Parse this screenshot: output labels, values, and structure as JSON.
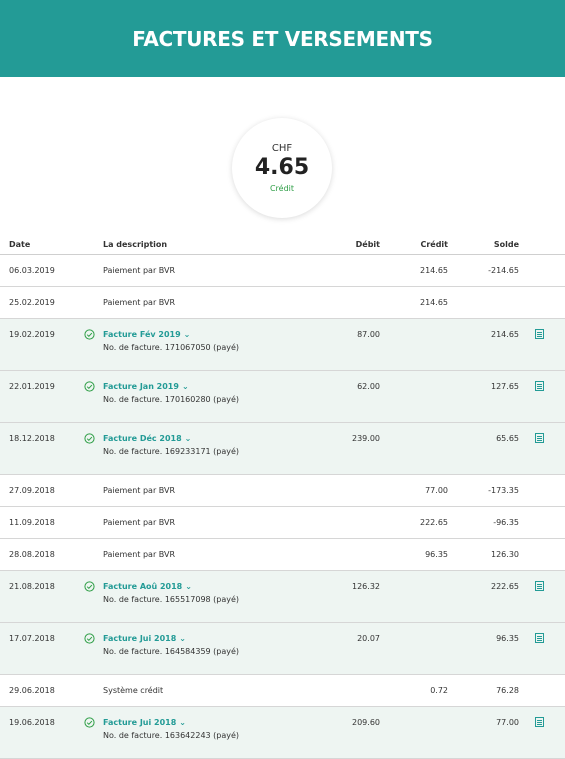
{
  "header": {
    "title": "FACTURES ET VERSEMENTS"
  },
  "balance": {
    "currency": "CHF",
    "amount": "4.65",
    "label": "Crédit"
  },
  "table": {
    "columns": {
      "date": "Date",
      "description": "La description",
      "debit": "Débit",
      "credit": "Crédit",
      "solde": "Solde"
    },
    "rows": [
      {
        "type": "simple",
        "date": "06.03.2019",
        "description": "Paiement par BVR",
        "debit": "",
        "credit": "214.65",
        "solde": "-214.65"
      },
      {
        "type": "simple",
        "date": "25.02.2019",
        "description": "Paiement par BVR",
        "debit": "",
        "credit": "214.65",
        "solde": ""
      },
      {
        "type": "invoice",
        "date": "19.02.2019",
        "title": "Facture Fév 2019",
        "number": "No. de facture. 171067050 (payé)",
        "debit": "87.00",
        "credit": "",
        "solde": "214.65"
      },
      {
        "type": "invoice",
        "date": "22.01.2019",
        "title": "Facture Jan 2019",
        "number": "No. de facture. 170160280 (payé)",
        "debit": "62.00",
        "credit": "",
        "solde": "127.65"
      },
      {
        "type": "invoice",
        "date": "18.12.2018",
        "title": "Facture Déc 2018",
        "number": "No. de facture. 169233171 (payé)",
        "debit": "239.00",
        "credit": "",
        "solde": "65.65"
      },
      {
        "type": "simple",
        "date": "27.09.2018",
        "description": "Paiement par BVR",
        "debit": "",
        "credit": "77.00",
        "solde": "-173.35"
      },
      {
        "type": "simple",
        "date": "11.09.2018",
        "description": "Paiement par BVR",
        "debit": "",
        "credit": "222.65",
        "solde": "-96.35"
      },
      {
        "type": "simple",
        "date": "28.08.2018",
        "description": "Paiement par BVR",
        "debit": "",
        "credit": "96.35",
        "solde": "126.30"
      },
      {
        "type": "invoice",
        "date": "21.08.2018",
        "title": "Facture Aoû 2018",
        "number": "No. de facture. 165517098 (payé)",
        "debit": "126.32",
        "credit": "",
        "solde": "222.65"
      },
      {
        "type": "invoice",
        "date": "17.07.2018",
        "title": "Facture Jui 2018",
        "number": "No. de facture. 164584359 (payé)",
        "debit": "20.07",
        "credit": "",
        "solde": "96.35"
      },
      {
        "type": "simple",
        "date": "29.06.2018",
        "description": "Système crédit",
        "debit": "",
        "credit": "0.72",
        "solde": "76.28"
      },
      {
        "type": "invoice",
        "date": "19.06.2018",
        "title": "Facture Jui 2018",
        "number": "No. de facture. 163642243 (payé)",
        "debit": "209.60",
        "credit": "",
        "solde": "77.00"
      }
    ]
  },
  "icons": {
    "paid": "check-circle-icon",
    "expand": "chevron-down-icon",
    "document": "document-icon"
  },
  "colors": {
    "accent": "#239b96",
    "credit": "#2e9e46",
    "invoice_row_bg": "#eef5f2"
  }
}
